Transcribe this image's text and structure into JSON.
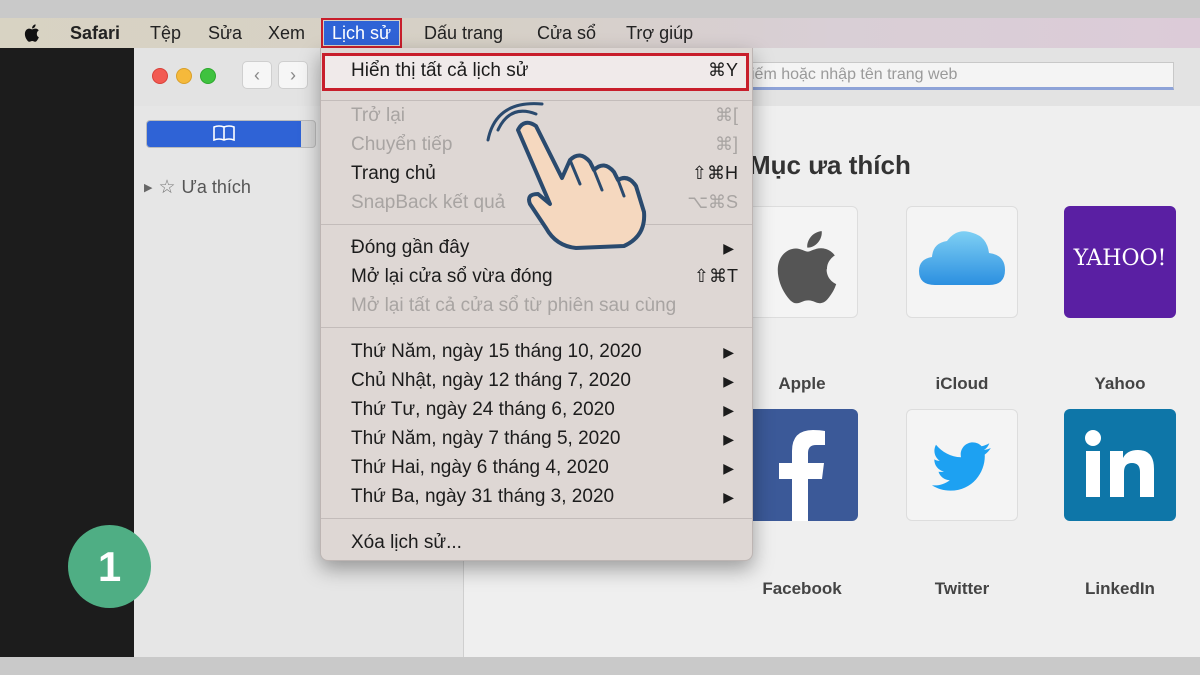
{
  "menubar": {
    "items": [
      "Safari",
      "Tệp",
      "Sửa",
      "Xem",
      "Lịch sử",
      "Dấu trang",
      "Cửa sổ",
      "Trợ giúp"
    ],
    "active": "Lịch sử"
  },
  "toolbar": {
    "address_placeholder": "Tìm kiếm hoặc nhập tên trang web",
    "address_visible": "iếm hoặc nhập tên trang web",
    "back_icon": "chevron-left-icon",
    "forward_icon": "chevron-right-icon"
  },
  "sidebar": {
    "bookmarks_icon": "book-icon",
    "favorites_label": "Ưa thích"
  },
  "content": {
    "title": "Mục ưa thích",
    "favorites": [
      {
        "label": "Apple"
      },
      {
        "label": "iCloud"
      },
      {
        "label": "Yahoo",
        "logo_text": "YAHOO!"
      },
      {
        "label": "Facebook"
      },
      {
        "label": "Twitter"
      },
      {
        "label": "LinkedIn"
      }
    ]
  },
  "history_menu": {
    "show_all": {
      "label": "Hiển thị tất cả lịch sử",
      "shortcut": "⌘Y"
    },
    "back": {
      "label": "Trở lại",
      "shortcut": "⌘["
    },
    "forward": {
      "label": "Chuyển tiếp",
      "shortcut": "⌘]"
    },
    "home": {
      "label": "Trang chủ",
      "shortcut": "⇧⌘H"
    },
    "snapback": {
      "label": "SnapBack kết quả",
      "shortcut": "⌥⌘S"
    },
    "recently_closed": {
      "label": "Đóng gần đây"
    },
    "reopen_window": {
      "label": "Mở lại cửa sổ vừa đóng",
      "shortcut": "⇧⌘T"
    },
    "reopen_all": {
      "label": "Mở lại tất cả cửa sổ từ phiên sau cùng"
    },
    "dates": [
      "Thứ Năm, ngày 15 tháng 10, 2020",
      "Chủ Nhật, ngày 12 tháng 7, 2020",
      "Thứ Tư, ngày 24 tháng 6, 2020",
      "Thứ Năm, ngày 7 tháng 5, 2020",
      "Thứ Hai, ngày 6 tháng 4, 2020",
      "Thứ Ba, ngày 31 tháng 3, 2020"
    ],
    "clear": {
      "label": "Xóa lịch sử..."
    }
  },
  "step": "1",
  "colors": {
    "menu_highlight": "#2f63d6",
    "annotation_red": "#c81e2b",
    "badge_green": "#4fae84"
  }
}
